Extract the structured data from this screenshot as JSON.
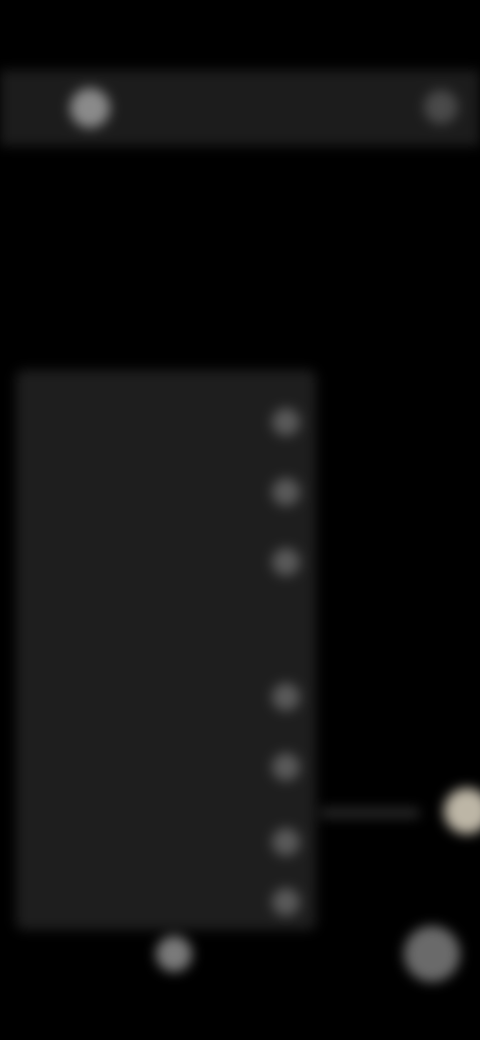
{
  "status_bar": {
    "time": "",
    "icons": ""
  },
  "app_bar": {
    "left_label": "",
    "title": ""
  },
  "panel": {
    "rows": [
      {
        "title": "",
        "subtitle": "",
        "has_toggle": true
      },
      {
        "title": "",
        "subtitle": "",
        "has_toggle": true
      },
      {
        "title": "",
        "subtitle": "",
        "has_toggle": true
      },
      {
        "title": "",
        "subtitle": "",
        "has_toggle": false
      },
      {
        "title": "",
        "subtitle": "",
        "has_toggle": true
      },
      {
        "title": "",
        "subtitle": "",
        "has_toggle": true
      },
      {
        "title": "",
        "subtitle": "",
        "has_toggle": true
      },
      {
        "title": "",
        "subtitle": "",
        "has_toggle": true
      }
    ]
  },
  "bottom_bar": {
    "label": ""
  },
  "colors": {
    "background": "#000000",
    "panel": "#1e1e1e",
    "accent": "#bdb6a6"
  },
  "icons": {
    "app_bar_left": "avatar-icon",
    "app_bar_right": "more-icon",
    "side_control": "slider-knob-icon",
    "bottom_left": "indicator-icon",
    "bottom_right": "fab-icon"
  }
}
